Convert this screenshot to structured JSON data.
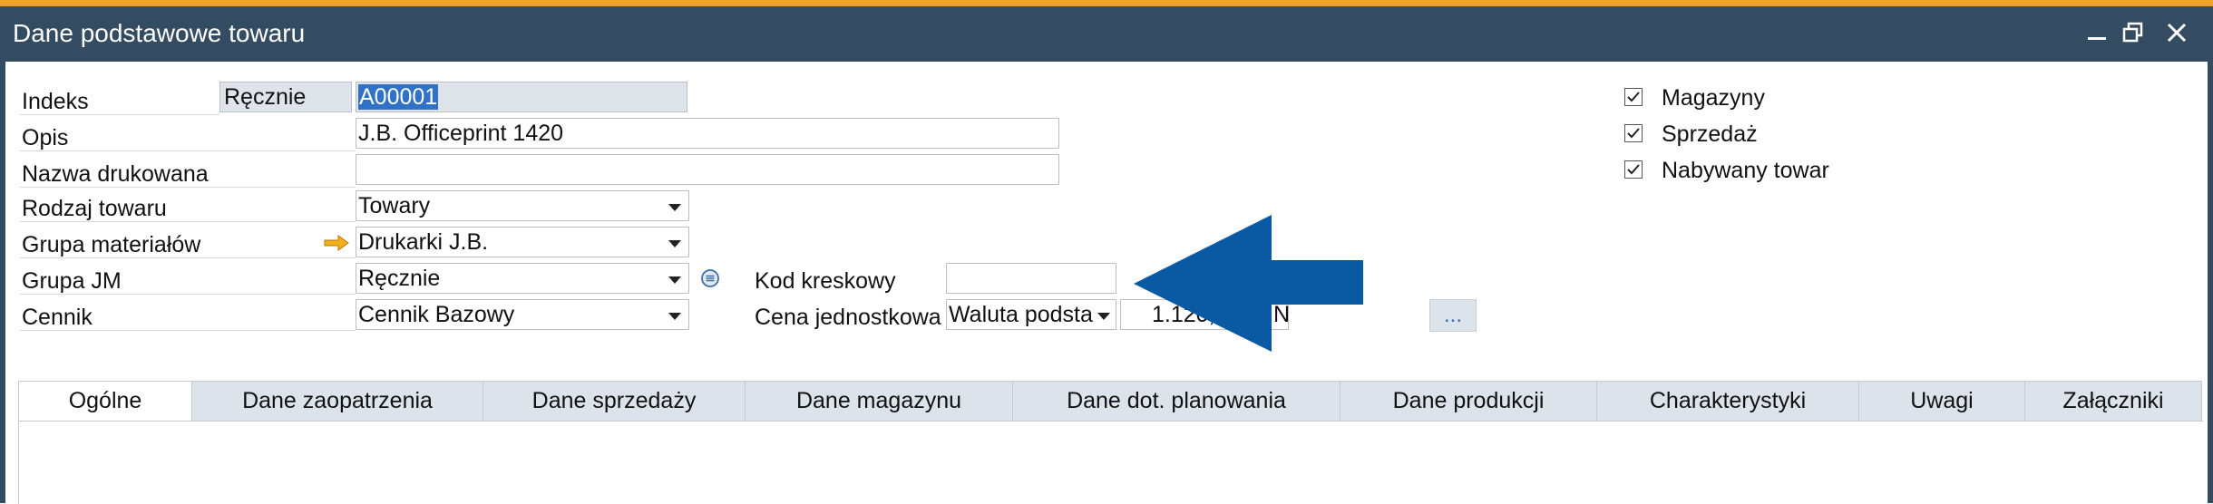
{
  "window": {
    "title": "Dane podstawowe towaru",
    "accent_color": "#f0a22a",
    "titlebar_color": "#344c61",
    "controls": [
      "minimize-icon",
      "restore-icon",
      "close-icon"
    ]
  },
  "form": {
    "item_code": {
      "label": "Indeks",
      "mode": "Ręcznie",
      "value": "A00001"
    },
    "description": {
      "label": "Opis",
      "value": "J.B. Officeprint 1420"
    },
    "foreign_name": {
      "label": "Nazwa drukowana",
      "value": ""
    },
    "item_type": {
      "label": "Rodzaj towaru",
      "value": "Towary"
    },
    "item_group": {
      "label": "Grupa materiałów",
      "value": "Drukarki J.B."
    },
    "uom_group": {
      "label": "Grupa JM",
      "value": "Ręcznie"
    },
    "price_list": {
      "label": "Cennik",
      "value": "Cennik Bazowy"
    },
    "barcode": {
      "label": "Kod kreskowy",
      "value": ""
    },
    "unit_price": {
      "label": "Cena jednostkowa",
      "currency_mode": "Waluta podsta",
      "amount": "1.120,",
      "amount_tail": "N"
    },
    "more_button": "..."
  },
  "checkboxes": [
    {
      "label": "Magazyny",
      "checked": true
    },
    {
      "label": "Sprzedaż",
      "checked": true
    },
    {
      "label": "Nabywany towar",
      "checked": true
    }
  ],
  "tabs": [
    "Ogólne",
    "Dane zaopatrzenia",
    "Dane sprzedaży",
    "Dane magazynu",
    "Dane dot. planowania",
    "Dane produkcji",
    "Charakterystyki",
    "Uwagi",
    "Załączniki"
  ],
  "annotation": {
    "icon": "big-blue-arrow-left",
    "color": "#0a5aa3"
  }
}
